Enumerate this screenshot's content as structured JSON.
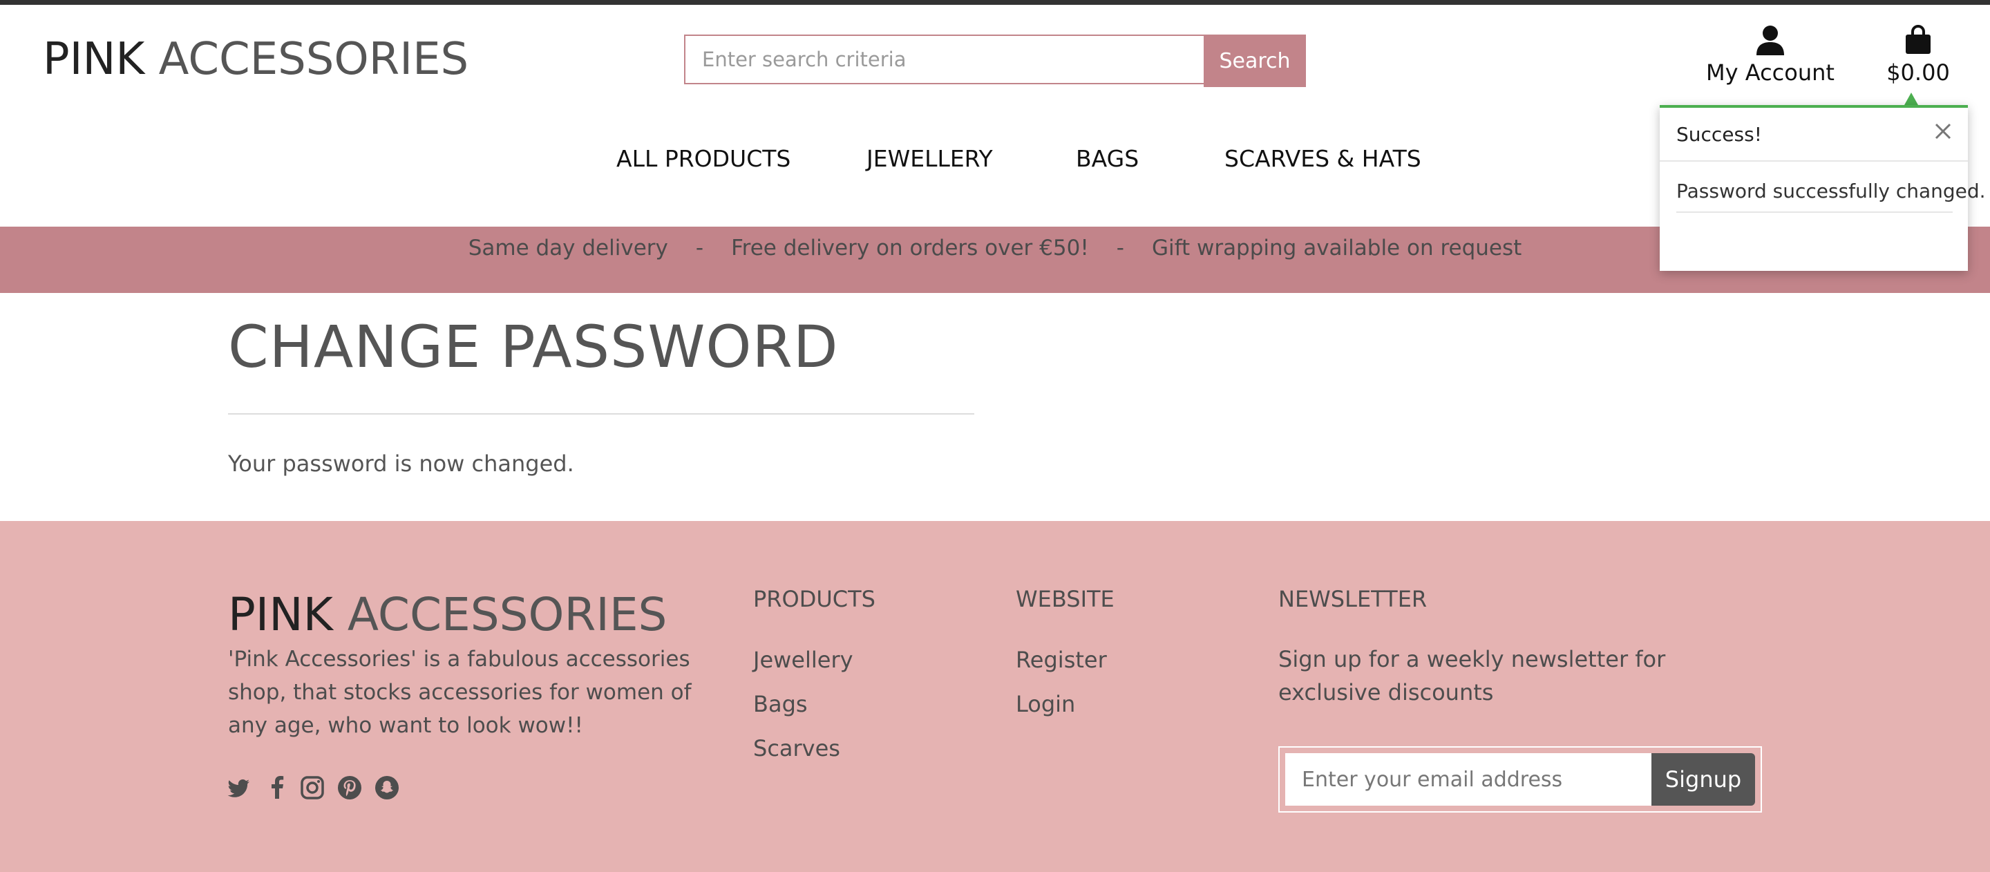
{
  "header": {
    "logo_first": "PINK",
    "logo_rest": " ACCESSORIES",
    "search_placeholder": "Enter search criteria",
    "search_button": "Search",
    "account_label": "My Account",
    "cart_total": "$0.00",
    "account_icon": "user-icon",
    "cart_icon": "shopping-bag-icon"
  },
  "nav": {
    "items": [
      "ALL PRODUCTS",
      "JEWELLERY",
      "BAGS",
      "SCARVES & HATS"
    ]
  },
  "promo": {
    "items": [
      "Same day delivery",
      "Free delivery on orders over €50!",
      "Gift wrapping available on request"
    ],
    "separator": "-"
  },
  "toast": {
    "title": "Success!",
    "message": "Password successfully changed.",
    "accent_color": "#4caf50"
  },
  "page": {
    "title": "CHANGE PASSWORD",
    "message": "Your password is now changed."
  },
  "footer": {
    "logo_first": "PINK",
    "logo_rest": " ACCESSORIES",
    "description": "'Pink Accessories' is a fabulous accessories shop, that stocks accessories for women of any age, who want to look wow!!",
    "social_icons": [
      "twitter-icon",
      "facebook-icon",
      "instagram-icon",
      "pinterest-icon",
      "snapchat-icon"
    ],
    "products": {
      "heading": "PRODUCTS",
      "links": [
        "Jewellery",
        "Bags",
        "Scarves"
      ]
    },
    "website": {
      "heading": "WEBSITE",
      "links": [
        "Register",
        "Login"
      ]
    },
    "newsletter": {
      "heading": "NEWSLETTER",
      "text": "Sign up for a weekly newsletter for exclusive discounts",
      "email_placeholder": "Enter your email address",
      "button": "Signup"
    }
  },
  "colors": {
    "brand_pink": "#c2848a",
    "footer_pink": "#e5b3b2",
    "success_green": "#4caf50"
  }
}
